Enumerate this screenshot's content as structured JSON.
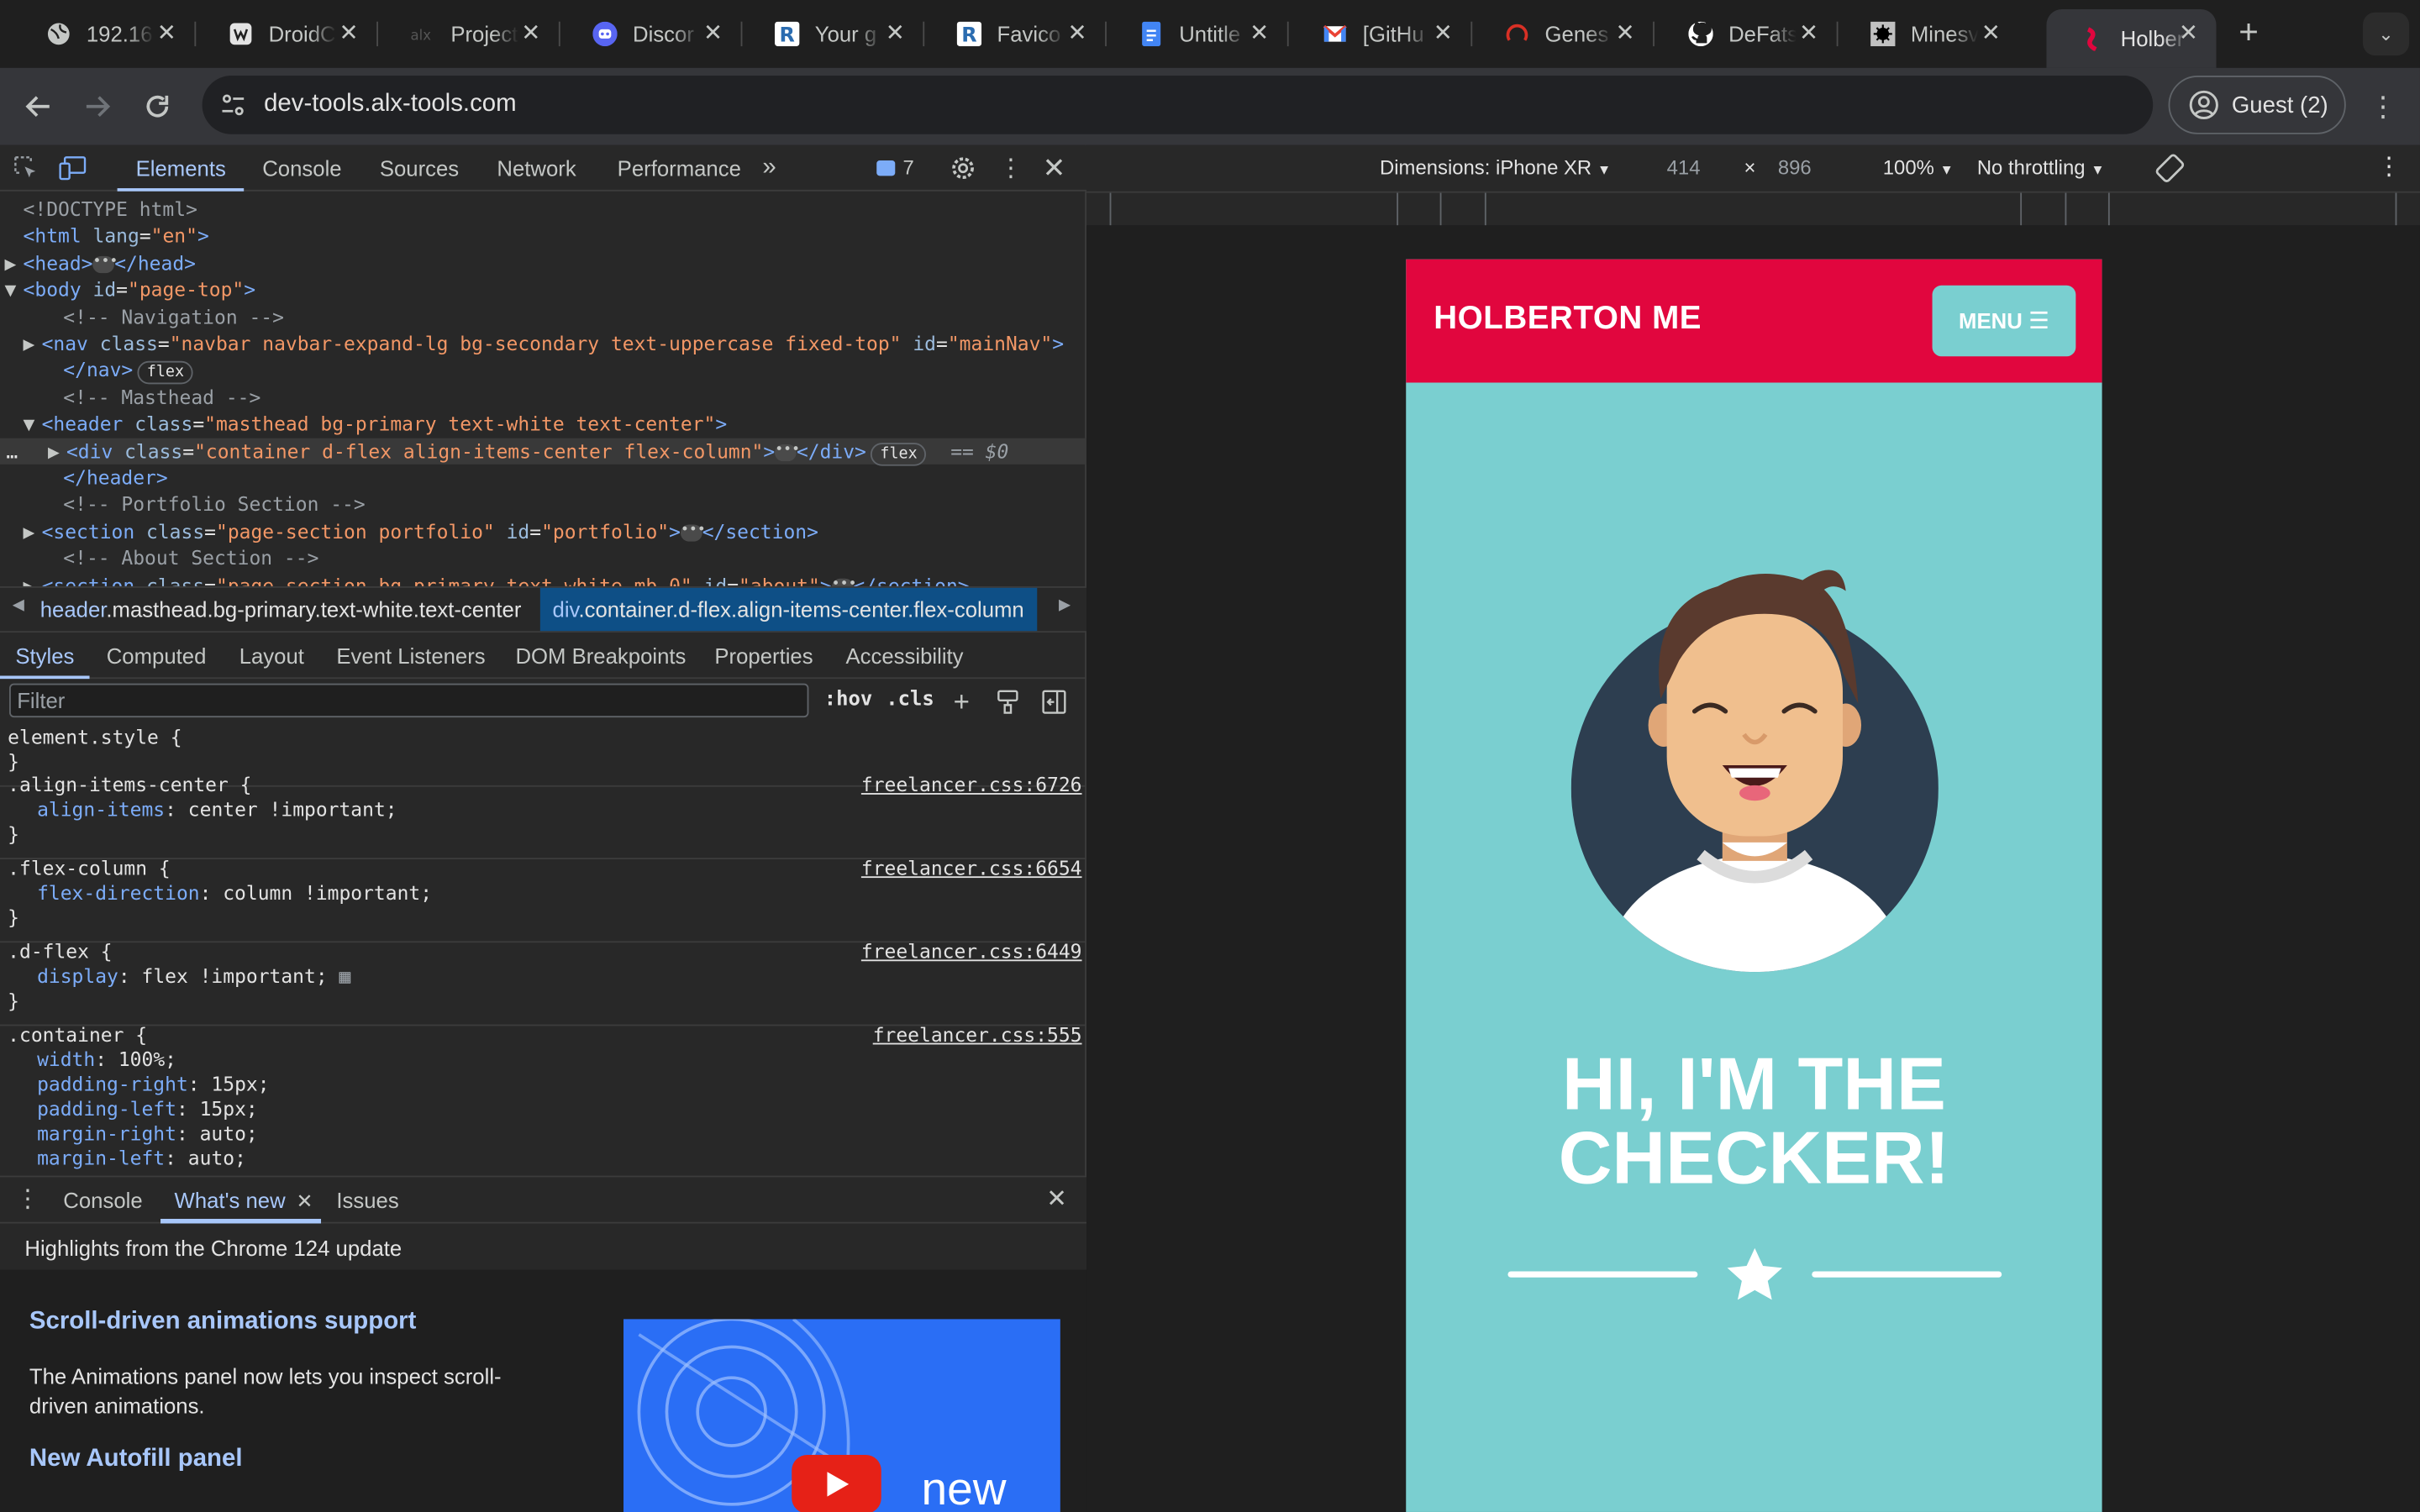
{
  "browser": {
    "tabs": [
      {
        "label": "192.16",
        "icon": "globe-icon"
      },
      {
        "label": "DroidC",
        "icon": "site-icon"
      },
      {
        "label": "Project",
        "icon": "alx-icon"
      },
      {
        "label": "Discor",
        "icon": "discord-icon"
      },
      {
        "label": "Your g",
        "icon": "r-icon"
      },
      {
        "label": "Favico",
        "icon": "r-icon"
      },
      {
        "label": "Untitle",
        "icon": "docs-icon"
      },
      {
        "label": "[GitHu",
        "icon": "gmail-icon"
      },
      {
        "label": "Genes",
        "icon": "genes-icon"
      },
      {
        "label": "DeFats",
        "icon": "github-icon"
      },
      {
        "label": "Minesv",
        "icon": "mine-icon"
      },
      {
        "label": "Holber",
        "icon": "holberton-icon",
        "active": true
      }
    ],
    "url": "dev-tools.alx-tools.com",
    "profile_label": "Guest (2)"
  },
  "devtools": {
    "tabs": [
      "Elements",
      "Console",
      "Sources",
      "Network",
      "Performance"
    ],
    "issues_count": "7",
    "tree": [
      {
        "doctype": "<!DOCTYPE html>"
      },
      {
        "open": "<html",
        "attrs": [
          [
            "lang",
            "\"en\""
          ]
        ],
        "close": ">"
      },
      {
        "open": "<head>",
        "dots": true,
        "close": "</head>"
      },
      {
        "open": "<body",
        "attrs": [
          [
            "id",
            "\"page-top\""
          ]
        ],
        "close": ">"
      },
      {
        "comment": "<!-- Navigation -->"
      },
      {
        "open": "<nav",
        "attrs": [
          [
            "class",
            "\"navbar navbar-expand-lg bg-secondary text-uppercase fixed-top\""
          ],
          [
            "id",
            "\"mainNav\""
          ]
        ],
        "close": ">"
      },
      {
        "close_tag": "</nav>",
        "pill": "flex"
      },
      {
        "comment": "<!-- Masthead -->"
      },
      {
        "open": "<header",
        "attrs": [
          [
            "class",
            "\"masthead bg-primary text-white text-center\""
          ]
        ],
        "close": ">"
      },
      {
        "open": "<div",
        "attrs": [
          [
            "class",
            "\"container d-flex align-items-center flex-column\""
          ]
        ],
        "close": ">",
        "dots_close": "</div>",
        "pill": "flex",
        "eq": "== $0"
      },
      {
        "close_tag": "</header>"
      },
      {
        "comment": "<!-- Portfolio Section -->"
      },
      {
        "open": "<section",
        "attrs": [
          [
            "class",
            "\"page-section portfolio\""
          ],
          [
            "id",
            "\"portfolio\""
          ]
        ],
        "close": ">",
        "dots_close": "</section>"
      },
      {
        "comment": "<!-- About Section -->"
      },
      {
        "open": "<section",
        "attrs": [
          [
            "class",
            "\"page-section bg-primary text-white mb-0\""
          ],
          [
            "id",
            "\"about\""
          ]
        ],
        "close": ">",
        "dots_close": "</section>"
      }
    ],
    "breadcrumb": {
      "first_tag": "header",
      "first_classes": ".masthead.bg-primary.text-white.text-center",
      "second_tag": "div",
      "second_classes": ".container.d-flex.align-items-center.flex-column"
    },
    "sub_tabs": [
      "Styles",
      "Computed",
      "Layout",
      "Event Listeners",
      "DOM Breakpoints",
      "Properties",
      "Accessibility"
    ],
    "filter_placeholder": "Filter",
    "hov": ":hov",
    "cls": ".cls",
    "rules": [
      {
        "selector": "element.style {",
        "source": "",
        "decls": [],
        "end": "}"
      },
      {
        "selector": ".align-items-center {",
        "source": "freelancer.css:6726",
        "decls": [
          [
            "align-items",
            "center !important;"
          ]
        ],
        "end": "}"
      },
      {
        "selector": ".flex-column {",
        "source": "freelancer.css:6654",
        "decls": [
          [
            "flex-direction",
            "column !important;"
          ]
        ],
        "end": "}"
      },
      {
        "selector": ".d-flex {",
        "source": "freelancer.css:6449",
        "decls": [
          [
            "display",
            "flex !important;"
          ]
        ],
        "end": "}"
      },
      {
        "selector": ".container {",
        "source": "freelancer.css:555",
        "decls": [
          [
            "width",
            "100%;"
          ],
          [
            "padding-right",
            "15px;"
          ],
          [
            "padding-left",
            "15px;"
          ],
          [
            "margin-right",
            "auto;"
          ],
          [
            "margin-left",
            "auto;"
          ]
        ],
        "end": ""
      }
    ],
    "drawer": {
      "tabs": [
        "Console",
        "What's new",
        "Issues"
      ],
      "highlights": "Highlights from the Chrome 124 update",
      "item1_title": "Scroll-driven animations support",
      "item1_text": "The Animations panel now lets you inspect scroll-driven animations.",
      "item2_title": "New Autofill panel",
      "thumb_text": "new"
    }
  },
  "device_toolbar": {
    "dimensions": "Dimensions: iPhone XR",
    "width": "414",
    "x": "×",
    "height": "896",
    "zoom": "100%",
    "throttling": "No throttling"
  },
  "page": {
    "brand": "HOLBERTON ME",
    "menu_label": "MENU",
    "hero_line1": "HI, I'M THE",
    "hero_line2": "CHECKER!",
    "colors": {
      "primary": "#7acfd0",
      "secondary": "#e1063e"
    }
  }
}
